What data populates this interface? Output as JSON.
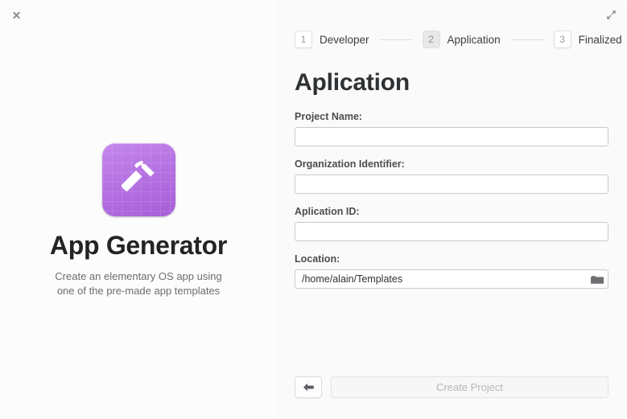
{
  "window": {
    "close_icon": "close-icon",
    "maximize_icon": "maximize-icon"
  },
  "branding": {
    "icon_name": "hammer-app-icon",
    "icon_color": "#b36ee0",
    "title": "App Generator",
    "description_line1": "Create an elementary OS app using",
    "description_line2": "one of the pre-made app templates"
  },
  "stepper": {
    "steps": [
      {
        "number": "1",
        "label": "Developer",
        "active": false
      },
      {
        "number": "2",
        "label": "Application",
        "active": true
      },
      {
        "number": "3",
        "label": "Finalized",
        "active": false
      }
    ]
  },
  "main": {
    "headline": "Aplication",
    "fields": [
      {
        "label": "Project Name:",
        "value": "",
        "placeholder": "",
        "has_folder_icon": false
      },
      {
        "label": "Organization Identifier:",
        "value": "",
        "placeholder": "",
        "has_folder_icon": false
      },
      {
        "label": "Aplication ID:",
        "value": "",
        "placeholder": "",
        "has_folder_icon": false
      },
      {
        "label": "Location:",
        "value": "/home/alain/Templates",
        "placeholder": "",
        "has_folder_icon": true,
        "folder_icon": "folder-icon"
      }
    ]
  },
  "footer": {
    "back_icon": "arrow-left-icon",
    "create_label": "Create Project",
    "create_enabled": false
  }
}
